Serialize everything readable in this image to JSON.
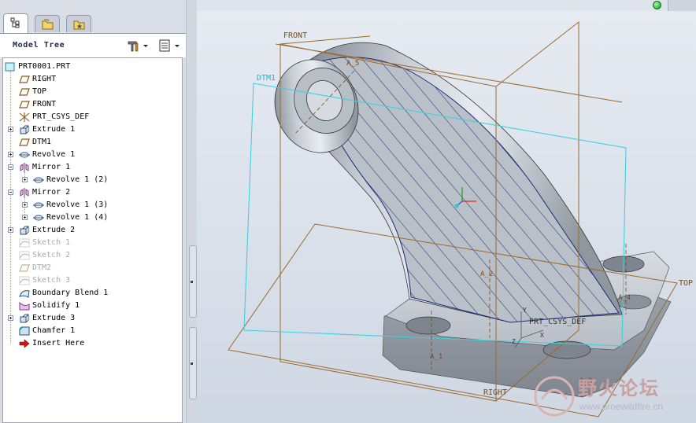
{
  "model_tree": {
    "title": "Model Tree",
    "root": "PRT0001.PRT",
    "items": [
      {
        "label": "RIGHT",
        "icon": "datum-plane-icon",
        "dim": false
      },
      {
        "label": "TOP",
        "icon": "datum-plane-icon",
        "dim": false
      },
      {
        "label": "FRONT",
        "icon": "datum-plane-icon",
        "dim": false
      },
      {
        "label": "PRT_CSYS_DEF",
        "icon": "coordinate-system-icon",
        "dim": false
      },
      {
        "label": "Extrude 1",
        "icon": "extrude-icon",
        "dim": false
      },
      {
        "label": "DTM1",
        "icon": "datum-plane-icon",
        "dim": false
      },
      {
        "label": "Revolve 1",
        "icon": "revolve-icon",
        "dim": false
      },
      {
        "label": "Mirror 1",
        "icon": "mirror-icon",
        "dim": false
      },
      {
        "label": "Revolve 1 (2)",
        "icon": "revolve-icon",
        "dim": false
      },
      {
        "label": "Mirror 2",
        "icon": "mirror-icon",
        "dim": false
      },
      {
        "label": "Revolve 1 (3)",
        "icon": "revolve-icon",
        "dim": false
      },
      {
        "label": "Revolve 1 (4)",
        "icon": "revolve-icon",
        "dim": false
      },
      {
        "label": "Extrude 2",
        "icon": "extrude-icon",
        "dim": false
      },
      {
        "label": "Sketch 1",
        "icon": "sketch-icon",
        "dim": true
      },
      {
        "label": "Sketch 2",
        "icon": "sketch-icon",
        "dim": true
      },
      {
        "label": "DTM2",
        "icon": "datum-plane-icon",
        "dim": true
      },
      {
        "label": "Sketch 3",
        "icon": "sketch-icon",
        "dim": true
      },
      {
        "label": "Boundary Blend 1",
        "icon": "boundary-blend-icon",
        "dim": false
      },
      {
        "label": "Solidify 1",
        "icon": "solidify-icon",
        "dim": false
      },
      {
        "label": "Extrude 3",
        "icon": "extrude-icon",
        "dim": false
      },
      {
        "label": "Chamfer 1",
        "icon": "chamfer-icon",
        "dim": false
      },
      {
        "label": "Insert Here",
        "icon": "insert-here-arrow-icon",
        "dim": false
      }
    ]
  },
  "viewport_labels": {
    "front": "FRONT",
    "dtm1": "DTM1",
    "top": "TOP",
    "right": "RIGHT",
    "csys": "PRT_CSYS_DEF",
    "axis_a5": "A_5",
    "axis_a2": "A_2",
    "axis_a4": "A_4",
    "axis_a1": "A_1",
    "axis_a3": "A_3",
    "csys_y": "Y",
    "csys_z": "Z",
    "csys_x": "X"
  },
  "watermark": {
    "title": "野火论坛",
    "url": "www.proewildfire.cn"
  },
  "colors": {
    "datum_plane": "#9b6a2e",
    "dtm1_plane": "#3fd0e0",
    "hatch": "#1a2a7a",
    "status_green": "#0a9a15"
  }
}
